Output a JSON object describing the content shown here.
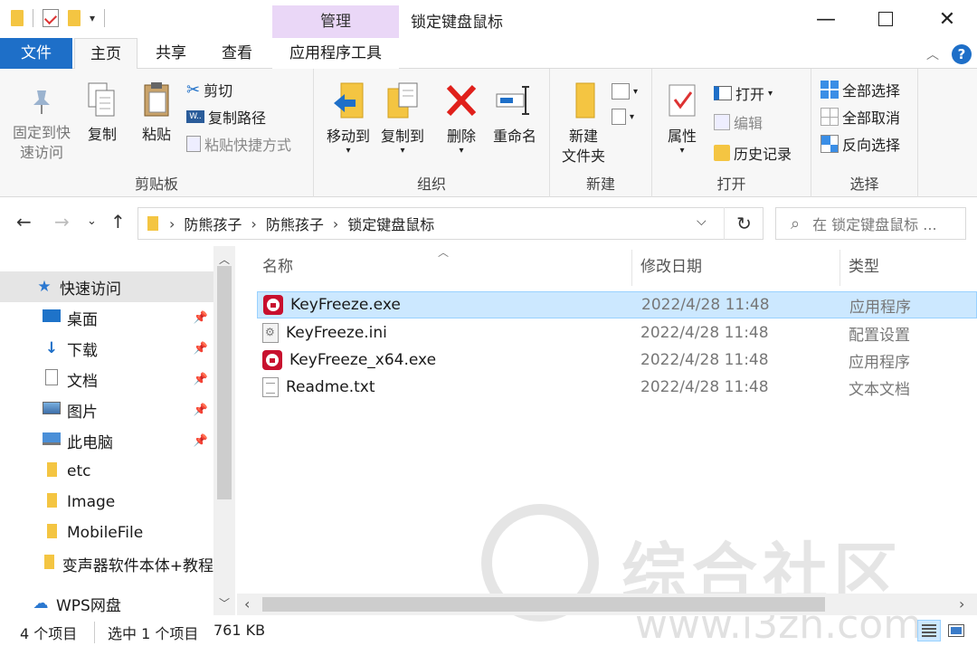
{
  "window": {
    "title": "锁定键盘鼠标",
    "context_tab": "管理",
    "minimize": "—",
    "close": "✕"
  },
  "tabs": {
    "file": "文件",
    "home": "主页",
    "share": "共享",
    "view": "查看",
    "app_tools": "应用程序工具"
  },
  "ribbon": {
    "clipboard": {
      "label": "剪贴板",
      "pin": "固定到快\n速访问",
      "pin_l1": "固定到快",
      "pin_l2": "速访问",
      "copy": "复制",
      "paste": "粘贴",
      "cut": "剪切",
      "copy_path": "复制路径",
      "paste_shortcut": "粘贴快捷方式"
    },
    "organize": {
      "label": "组织",
      "move_to": "移动到",
      "copy_to": "复制到",
      "delete": "删除",
      "rename": "重命名"
    },
    "new": {
      "label": "新建",
      "new_folder_l1": "新建",
      "new_folder_l2": "文件夹"
    },
    "open": {
      "label": "打开",
      "properties": "属性",
      "open": "打开",
      "edit": "编辑",
      "history": "历史记录"
    },
    "select": {
      "label": "选择",
      "select_all": "全部选择",
      "select_none": "全部取消",
      "invert": "反向选择"
    }
  },
  "address": {
    "crumbs": [
      "防熊孩子",
      "防熊孩子",
      "锁定键盘鼠标"
    ],
    "search_placeholder": "在 锁定键盘鼠标 ..."
  },
  "nav": {
    "items": [
      {
        "label": "快速访问"
      },
      {
        "label": "桌面"
      },
      {
        "label": "下载"
      },
      {
        "label": "文档"
      },
      {
        "label": "图片"
      },
      {
        "label": "此电脑"
      },
      {
        "label": "etc"
      },
      {
        "label": "Image"
      },
      {
        "label": "MobileFile"
      },
      {
        "label": "变声器软件本体+教程"
      },
      {
        "label": "WPS网盘"
      }
    ]
  },
  "columns": {
    "name": "名称",
    "date": "修改日期",
    "type": "类型"
  },
  "files": [
    {
      "name": "KeyFreeze.exe",
      "date": "2022/4/28 11:48",
      "type": "应用程序",
      "icon": "lock-app-icon",
      "selected": true
    },
    {
      "name": "KeyFreeze.ini",
      "date": "2022/4/28 11:48",
      "type": "配置设置",
      "icon": "config-file-icon",
      "selected": false
    },
    {
      "name": "KeyFreeze_x64.exe",
      "date": "2022/4/28 11:48",
      "type": "应用程序",
      "icon": "lock-app-icon",
      "selected": false
    },
    {
      "name": "Readme.txt",
      "date": "2022/4/28 11:48",
      "type": "文本文档",
      "icon": "text-file-icon",
      "selected": false
    }
  ],
  "watermark": {
    "text": "综合社区",
    "url": "www.i3zh.com"
  },
  "status": {
    "count": "4 个项目",
    "selected": "选中 1 个项目",
    "size": "761 KB"
  },
  "colors": {
    "accent": "#1e6fc8",
    "context_tab": "#ead7f7",
    "selection": "#cce8ff",
    "delete_red": "#e0201b"
  }
}
